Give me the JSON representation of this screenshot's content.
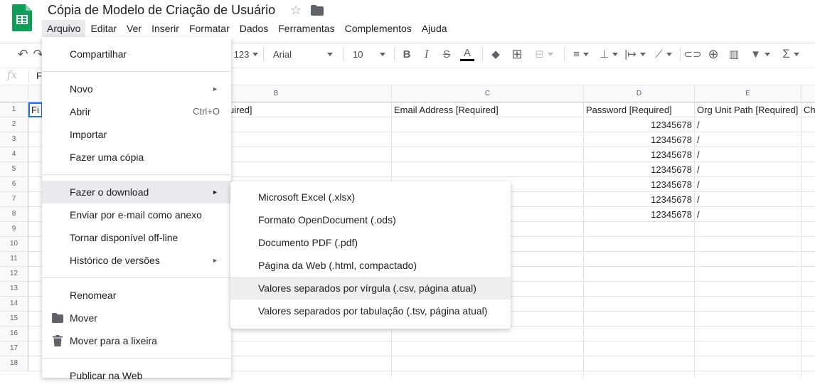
{
  "doc": {
    "title": "Cópia de Modelo de Criação de Usuário"
  },
  "menubar": [
    "Arquivo",
    "Editar",
    "Ver",
    "Inserir",
    "Formatar",
    "Dados",
    "Ferramentas",
    "Complementos",
    "Ajuda"
  ],
  "toolbar": {
    "number_format": "123",
    "font": "Arial",
    "font_size": "10"
  },
  "formula_bar": {
    "fx": "fx",
    "value": "F"
  },
  "columns": [
    "B",
    "C",
    "D",
    "E"
  ],
  "rows": [
    "1",
    "2",
    "3",
    "4",
    "5",
    "6",
    "7",
    "8",
    "9",
    "10",
    "11",
    "12",
    "13",
    "14",
    "15",
    "16",
    "17",
    "18"
  ],
  "cells": {
    "a1": "Fi",
    "b1": "uired]",
    "c1": "Email Address [Required]",
    "d1": "Password [Required]",
    "e1": "Org Unit Path [Required]",
    "f1": "Ch",
    "passwords": [
      "12345678",
      "12345678",
      "12345678",
      "12345678",
      "12345678",
      "12345678",
      "12345678"
    ],
    "paths": [
      "/",
      "/",
      "/",
      "/",
      "/",
      "/",
      "/"
    ]
  },
  "file_menu": {
    "share": "Compartilhar",
    "new": "Novo",
    "open": "Abrir",
    "open_shortcut": "Ctrl+O",
    "import": "Importar",
    "copy": "Fazer uma cópia",
    "download": "Fazer o download",
    "email": "Enviar por e-mail como anexo",
    "offline": "Tornar disponível off-line",
    "history": "Histórico de versões",
    "rename": "Renomear",
    "move": "Mover",
    "trash": "Mover para a lixeira",
    "publish": "Publicar na Web"
  },
  "download_menu": {
    "xlsx": "Microsoft Excel (.xlsx)",
    "ods": "Formato OpenDocument (.ods)",
    "pdf": "Documento PDF (.pdf)",
    "html": "Página da Web (.html, compactado)",
    "csv": "Valores separados por vírgula (.csv, página atual)",
    "tsv": "Valores separados por tabulação (.tsv, página atual)"
  },
  "colors": {
    "sheets_green": "#0f9d58",
    "menu_highlight": "#e8eaed",
    "grid_line": "#e2e3e3"
  }
}
